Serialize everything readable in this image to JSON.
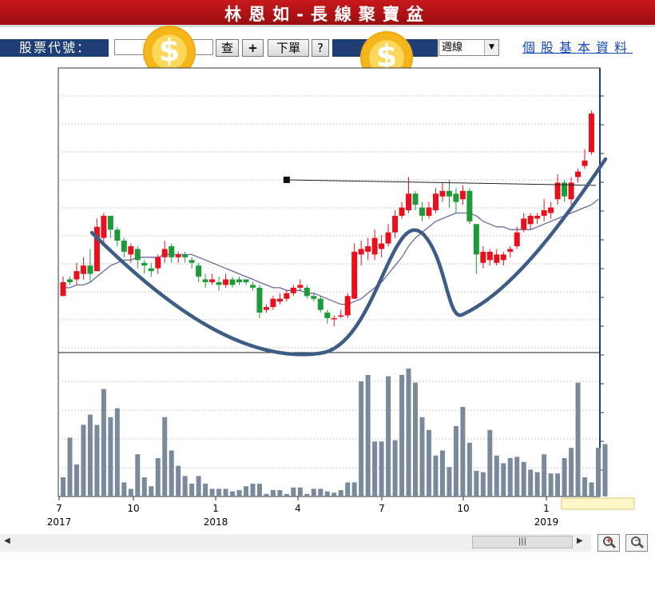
{
  "title": "林恩如-長線聚寶盆",
  "toolbar": {
    "stock_code_label": "股票代號：",
    "stock_code_value": "",
    "query_button": "查",
    "add_button": "+",
    "order_button": "下單",
    "help_button": "?",
    "period_select": "週線",
    "info_link": "個股基本資料"
  },
  "icons": {
    "coin": "dollar-coin-icon",
    "coin_symbol": "$"
  },
  "colors": {
    "up": "#e8101c",
    "down": "#1e9a38",
    "ma": "#6a6aa0",
    "volume": "#7a8a9c",
    "pattern": "#3d5d86",
    "header": "#1f3f74",
    "title": "#b3141a"
  },
  "chart_data": {
    "type": "candlestick",
    "x_tick_labels": [
      "7",
      "10",
      "1",
      "4",
      "7",
      "10",
      "1"
    ],
    "x_year_labels": [
      "2017",
      "2018",
      "2019"
    ],
    "grid": true,
    "candles": [
      {
        "o": 0.19,
        "c": 0.24,
        "h": 0.26,
        "l": 0.19
      },
      {
        "o": 0.25,
        "c": 0.24,
        "h": 0.26,
        "l": 0.23
      },
      {
        "o": 0.25,
        "c": 0.28,
        "h": 0.31,
        "l": 0.23
      },
      {
        "o": 0.27,
        "c": 0.3,
        "h": 0.33,
        "l": 0.25
      },
      {
        "o": 0.3,
        "c": 0.27,
        "h": 0.36,
        "l": 0.24
      },
      {
        "o": 0.28,
        "c": 0.44,
        "h": 0.47,
        "l": 0.28
      },
      {
        "o": 0.4,
        "c": 0.48,
        "h": 0.49,
        "l": 0.38
      },
      {
        "o": 0.48,
        "c": 0.43,
        "h": 0.48,
        "l": 0.4
      },
      {
        "o": 0.43,
        "c": 0.39,
        "h": 0.44,
        "l": 0.37
      },
      {
        "o": 0.39,
        "c": 0.35,
        "h": 0.4,
        "l": 0.33
      },
      {
        "o": 0.34,
        "c": 0.37,
        "h": 0.38,
        "l": 0.31
      },
      {
        "o": 0.36,
        "c": 0.32,
        "h": 0.37,
        "l": 0.29
      },
      {
        "o": 0.31,
        "c": 0.3,
        "h": 0.32,
        "l": 0.27
      },
      {
        "o": 0.29,
        "c": 0.28,
        "h": 0.31,
        "l": 0.26
      },
      {
        "o": 0.29,
        "c": 0.33,
        "h": 0.34,
        "l": 0.27
      },
      {
        "o": 0.33,
        "c": 0.36,
        "h": 0.39,
        "l": 0.31
      },
      {
        "o": 0.37,
        "c": 0.33,
        "h": 0.38,
        "l": 0.31
      },
      {
        "o": 0.33,
        "c": 0.34,
        "h": 0.35,
        "l": 0.31
      },
      {
        "o": 0.34,
        "c": 0.33,
        "h": 0.35,
        "l": 0.31
      },
      {
        "o": 0.32,
        "c": 0.31,
        "h": 0.33,
        "l": 0.29
      },
      {
        "o": 0.3,
        "c": 0.26,
        "h": 0.31,
        "l": 0.24
      },
      {
        "o": 0.25,
        "c": 0.24,
        "h": 0.27,
        "l": 0.22
      },
      {
        "o": 0.24,
        "c": 0.25,
        "h": 0.27,
        "l": 0.23
      },
      {
        "o": 0.24,
        "c": 0.23,
        "h": 0.26,
        "l": 0.21
      },
      {
        "o": 0.23,
        "c": 0.25,
        "h": 0.27,
        "l": 0.22
      },
      {
        "o": 0.25,
        "c": 0.23,
        "h": 0.26,
        "l": 0.22
      },
      {
        "o": 0.25,
        "c": 0.24,
        "h": 0.26,
        "l": 0.23
      },
      {
        "o": 0.25,
        "c": 0.24,
        "h": 0.25,
        "l": 0.23
      },
      {
        "o": 0.23,
        "c": 0.22,
        "h": 0.24,
        "l": 0.21
      },
      {
        "o": 0.22,
        "c": 0.13,
        "h": 0.23,
        "l": 0.11
      },
      {
        "o": 0.14,
        "c": 0.15,
        "h": 0.16,
        "l": 0.13
      },
      {
        "o": 0.15,
        "c": 0.18,
        "h": 0.19,
        "l": 0.14
      },
      {
        "o": 0.17,
        "c": 0.18,
        "h": 0.2,
        "l": 0.16
      },
      {
        "o": 0.18,
        "c": 0.2,
        "h": 0.21,
        "l": 0.17
      },
      {
        "o": 0.2,
        "c": 0.22,
        "h": 0.23,
        "l": 0.19
      },
      {
        "o": 0.22,
        "c": 0.23,
        "h": 0.25,
        "l": 0.21
      },
      {
        "o": 0.22,
        "c": 0.19,
        "h": 0.23,
        "l": 0.18
      },
      {
        "o": 0.19,
        "c": 0.18,
        "h": 0.2,
        "l": 0.17
      },
      {
        "o": 0.18,
        "c": 0.14,
        "h": 0.19,
        "l": 0.13
      },
      {
        "o": 0.13,
        "c": 0.11,
        "h": 0.14,
        "l": 0.09
      },
      {
        "o": 0.11,
        "c": 0.11,
        "h": 0.12,
        "l": 0.08
      },
      {
        "o": 0.12,
        "c": 0.12,
        "h": 0.14,
        "l": 0.11
      },
      {
        "o": 0.12,
        "c": 0.19,
        "h": 0.2,
        "l": 0.11
      },
      {
        "o": 0.18,
        "c": 0.35,
        "h": 0.38,
        "l": 0.18
      },
      {
        "o": 0.34,
        "c": 0.36,
        "h": 0.39,
        "l": 0.3
      },
      {
        "o": 0.35,
        "c": 0.37,
        "h": 0.4,
        "l": 0.32
      },
      {
        "o": 0.34,
        "c": 0.4,
        "h": 0.43,
        "l": 0.32
      },
      {
        "o": 0.36,
        "c": 0.38,
        "h": 0.41,
        "l": 0.33
      },
      {
        "o": 0.38,
        "c": 0.42,
        "h": 0.45,
        "l": 0.37
      },
      {
        "o": 0.42,
        "c": 0.48,
        "h": 0.5,
        "l": 0.4
      },
      {
        "o": 0.48,
        "c": 0.51,
        "h": 0.53,
        "l": 0.47
      },
      {
        "o": 0.5,
        "c": 0.56,
        "h": 0.62,
        "l": 0.49
      },
      {
        "o": 0.56,
        "c": 0.52,
        "h": 0.57,
        "l": 0.5
      },
      {
        "o": 0.51,
        "c": 0.48,
        "h": 0.53,
        "l": 0.46
      },
      {
        "o": 0.48,
        "c": 0.51,
        "h": 0.53,
        "l": 0.47
      },
      {
        "o": 0.5,
        "c": 0.56,
        "h": 0.58,
        "l": 0.49
      },
      {
        "o": 0.55,
        "c": 0.57,
        "h": 0.6,
        "l": 0.53
      },
      {
        "o": 0.57,
        "c": 0.55,
        "h": 0.61,
        "l": 0.51
      },
      {
        "o": 0.56,
        "c": 0.53,
        "h": 0.58,
        "l": 0.49
      },
      {
        "o": 0.54,
        "c": 0.57,
        "h": 0.59,
        "l": 0.52
      },
      {
        "o": 0.57,
        "c": 0.46,
        "h": 0.58,
        "l": 0.45
      },
      {
        "o": 0.45,
        "c": 0.34,
        "h": 0.45,
        "l": 0.27
      },
      {
        "o": 0.31,
        "c": 0.35,
        "h": 0.37,
        "l": 0.29
      },
      {
        "o": 0.32,
        "c": 0.35,
        "h": 0.36,
        "l": 0.3
      },
      {
        "o": 0.31,
        "c": 0.34,
        "h": 0.36,
        "l": 0.3
      },
      {
        "o": 0.32,
        "c": 0.34,
        "h": 0.35,
        "l": 0.3
      },
      {
        "o": 0.35,
        "c": 0.36,
        "h": 0.37,
        "l": 0.33
      },
      {
        "o": 0.37,
        "c": 0.42,
        "h": 0.44,
        "l": 0.36
      },
      {
        "o": 0.43,
        "c": 0.47,
        "h": 0.49,
        "l": 0.42
      },
      {
        "o": 0.45,
        "c": 0.48,
        "h": 0.49,
        "l": 0.43
      },
      {
        "o": 0.47,
        "c": 0.48,
        "h": 0.49,
        "l": 0.45
      },
      {
        "o": 0.48,
        "c": 0.5,
        "h": 0.54,
        "l": 0.46
      },
      {
        "o": 0.49,
        "c": 0.51,
        "h": 0.53,
        "l": 0.47
      },
      {
        "o": 0.54,
        "c": 0.6,
        "h": 0.63,
        "l": 0.52
      },
      {
        "o": 0.6,
        "c": 0.55,
        "h": 0.61,
        "l": 0.53
      },
      {
        "o": 0.54,
        "c": 0.6,
        "h": 0.62,
        "l": 0.52
      },
      {
        "o": 0.62,
        "c": 0.64,
        "h": 0.65,
        "l": 0.6
      },
      {
        "o": 0.66,
        "c": 0.68,
        "h": 0.72,
        "l": 0.65
      },
      {
        "o": 0.71,
        "c": 0.85,
        "h": 0.86,
        "l": 0.7
      }
    ],
    "ma": [
      0.22,
      0.22,
      0.23,
      0.23,
      0.24,
      0.26,
      0.28,
      0.3,
      0.31,
      0.32,
      0.32,
      0.33,
      0.33,
      0.33,
      0.33,
      0.34,
      0.34,
      0.34,
      0.34,
      0.34,
      0.33,
      0.32,
      0.31,
      0.3,
      0.29,
      0.28,
      0.27,
      0.26,
      0.25,
      0.24,
      0.23,
      0.22,
      0.22,
      0.21,
      0.21,
      0.21,
      0.2,
      0.2,
      0.19,
      0.18,
      0.17,
      0.16,
      0.16,
      0.17,
      0.18,
      0.2,
      0.22,
      0.24,
      0.27,
      0.3,
      0.33,
      0.37,
      0.4,
      0.42,
      0.44,
      0.46,
      0.47,
      0.48,
      0.49,
      0.49,
      0.49,
      0.48,
      0.46,
      0.45,
      0.44,
      0.44,
      0.43,
      0.43,
      0.43,
      0.43,
      0.44,
      0.45,
      0.46,
      0.47,
      0.48,
      0.49,
      0.5,
      0.51,
      0.52,
      0.54
    ],
    "volumes": [
      0.15,
      0.46,
      0.25,
      0.56,
      0.64,
      0.56,
      0.84,
      0.62,
      0.69,
      0.11,
      0.06,
      0.33,
      0.15,
      0.08,
      0.3,
      0.62,
      0.36,
      0.24,
      0.16,
      0.1,
      0.16,
      0.1,
      0.06,
      0.06,
      0.06,
      0.04,
      0.05,
      0.08,
      0.1,
      0.1,
      0.02,
      0.05,
      0.05,
      0.02,
      0.07,
      0.07,
      0.02,
      0.06,
      0.06,
      0.04,
      0.03,
      0.05,
      0.11,
      0.11,
      0.9,
      0.95,
      0.43,
      0.43,
      0.94,
      0.44,
      0.95,
      1.0,
      0.89,
      0.62,
      0.52,
      0.32,
      0.36,
      0.23,
      0.55,
      0.7,
      0.42,
      0.2,
      0.19,
      0.52,
      0.32,
      0.26,
      0.3,
      0.31,
      0.27,
      0.21,
      0.19,
      0.33,
      0.18,
      0.18,
      0.3,
      0.38,
      0.89,
      0.15,
      0.11,
      0.38,
      0.41
    ],
    "resistance_line": {
      "from": 0.61,
      "to": 0.59
    },
    "pattern_curve": true
  }
}
